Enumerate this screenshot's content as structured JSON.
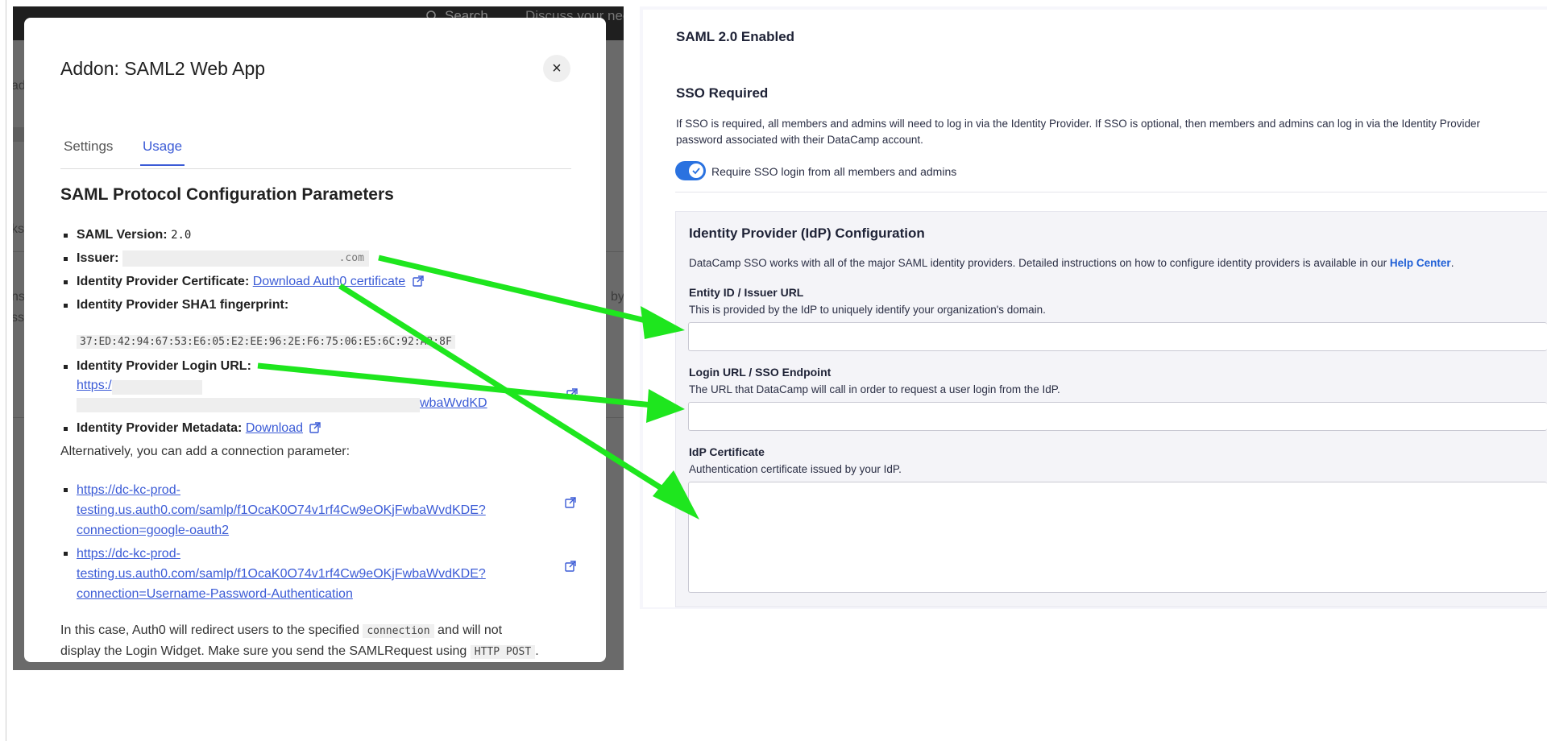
{
  "background_app": {
    "search_label": "Search",
    "discuss_label": "Discuss your nee",
    "frag_ad": "ad",
    "frag_ks": "ks",
    "frag_ns": "ns",
    "frag_ss": "ss",
    "frag_by": "by"
  },
  "modal": {
    "title": "Addon: SAML2 Web App",
    "close_label": "×",
    "tabs": [
      {
        "label": "Settings"
      },
      {
        "label": "Usage"
      }
    ],
    "section_title": "SAML Protocol Configuration Parameters",
    "params": {
      "saml_version_label": "SAML Version:",
      "saml_version_value": "2.0",
      "issuer_label": "Issuer:",
      "issuer_value": ".com",
      "cert_label": "Identity Provider Certificate:",
      "cert_link": "Download Auth0 certificate",
      "sha1_label": "Identity Provider SHA1 fingerprint:",
      "sha1_value": "37:ED:42:94:67:53:E6:05:E2:EE:96:2E:F6:75:06:E5:6C:92:A2:8F",
      "login_url_label": "Identity Provider Login URL:",
      "login_url_start": "https:/",
      "login_url_end": "wbaWvdKD",
      "metadata_label": "Identity Provider Metadata:",
      "metadata_link": "Download"
    },
    "alt_text": "Alternatively, you can add a connection parameter:",
    "connections": [
      {
        "line1": "https://dc-kc-prod-",
        "line2": "testing.us.auth0.com/samlp/f1OcaK0O74v1rf4Cw9eOKjFwbaWvdKDE?",
        "line3": "connection=google-oauth2"
      },
      {
        "line1": "https://dc-kc-prod-",
        "line2": "testing.us.auth0.com/samlp/f1OcaK0O74v1rf4Cw9eOKjFwbaWvdKDE?",
        "line3": "connection=Username-Password-Authentication"
      }
    ],
    "footer_text_1": "In this case, Auth0 will redirect users to the specified",
    "footer_code_1": "connection",
    "footer_text_2": "and will not",
    "footer_text_3": "display the Login Widget. Make sure you send the SAMLRequest using",
    "footer_code_2": "HTTP POST",
    "footer_text_4": "."
  },
  "saml_panel": {
    "enabled_title": "SAML 2.0 Enabled",
    "sso_title": "SSO Required",
    "sso_desc_1": "If SSO is required, all members and admins will need to log in via the Identity Provider. If SSO is optional, then members and admins can log in via the Identity Provider",
    "sso_desc_2": "password associated with their DataCamp account.",
    "toggle_label": "Require SSO login from all members and admins",
    "toggle_on": true,
    "idp_title": "Identity Provider (IdP) Configuration",
    "idp_desc": "DataCamp SSO works with all of the major SAML identity providers. Detailed instructions on how to configure identity providers is available in our",
    "help_center": "Help Center",
    "idp_desc_end": ".",
    "entity_label": "Entity ID / Issuer URL",
    "entity_help": "This is provided by the IdP to uniquely identify your organization's domain.",
    "login_label": "Login URL / SSO Endpoint",
    "login_help": "The URL that DataCamp will call in order to request a user login from the IdP.",
    "cert_label": "IdP Certificate",
    "cert_help": "Authentication certificate issued by your IdP."
  },
  "colors": {
    "accent": "#3b5bd6",
    "toggle": "#2a72e0",
    "arrow": "#1ee61e",
    "overlay": "#6a6a6a"
  }
}
